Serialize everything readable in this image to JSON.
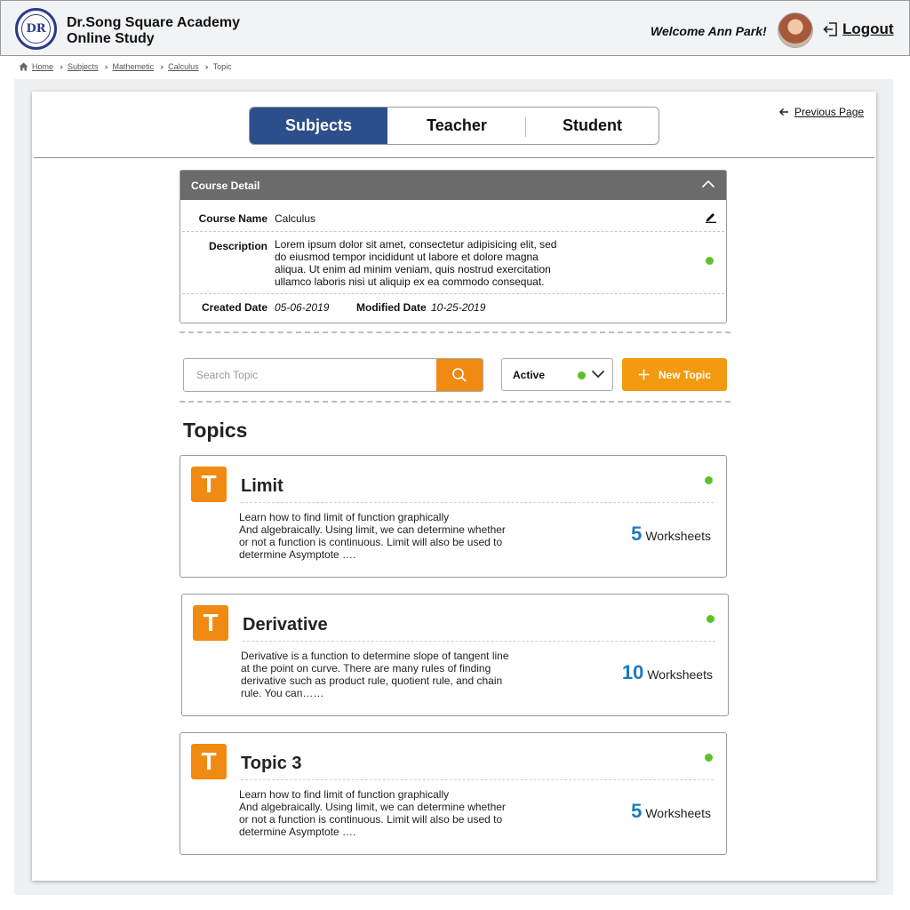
{
  "header": {
    "logo_text": "DR",
    "title_line1": "Dr.Song Square Academy",
    "title_line2": "Online Study",
    "welcome": "Welcome Ann Park!",
    "logout_label": "Logout"
  },
  "breadcrumb": {
    "items": [
      "Home",
      "Subjects",
      "Mathemetic",
      "Calculus",
      "Topic"
    ]
  },
  "tabs": {
    "subjects": "Subjects",
    "teacher": "Teacher",
    "student": "Student",
    "active": "Subjects",
    "active_color": "#2c4f8c"
  },
  "previous_page_label": "Previous Page",
  "course_detail": {
    "header": "Course Detail",
    "name_label": "Course Name",
    "name_value": "Calculus",
    "description_label": "Description",
    "description_lines": [
      "Lorem ipsum dolor sit amet, consectetur adipisicing elit, sed",
      "do eiusmod tempor incididunt ut labore et dolore magna",
      "aliqua. Ut enim ad minim veniam, quis nostrud exercitation",
      "ullamco laboris nisi ut aliquip ex ea commodo consequat."
    ],
    "created_label": "Created Date",
    "created_value": "05-06-2019",
    "modified_label": "Modified Date",
    "modified_value": "10-25-2019",
    "status_color": "#5cc22a"
  },
  "search": {
    "placeholder": "Search Topic",
    "button_color": "#f08a12"
  },
  "status_filter": {
    "value": "Active",
    "dot_color": "#5cc22a"
  },
  "new_topic_label": "New Topic",
  "topics_title": "Topics",
  "topics": [
    {
      "icon_letter": "T",
      "name": "Limit",
      "desc_lines": [
        "Learn how to find limit of function graphically",
        "And algebraically. Using limit, we can determine whether",
        "or not a function is continuous. Limit will also be used to",
        "determine Asymptote …."
      ],
      "worksheet_count": "5",
      "worksheet_label": "Worksheets"
    },
    {
      "icon_letter": "T",
      "name": "Derivative",
      "desc_lines": [
        "Derivative is a function to determine slope of tangent line",
        "at the point on curve. There are many rules of finding",
        "derivative such as product rule, quotient rule, and chain",
        "rule. You can……"
      ],
      "worksheet_count": "10",
      "worksheet_label": "Worksheets"
    },
    {
      "icon_letter": "T",
      "name": "Topic 3",
      "desc_lines": [
        "Learn how to find limit of function graphically",
        "And algebraically. Using limit, we can determine whether",
        "or not a function is continuous. Limit will also be used to",
        "determine Asymptote …."
      ],
      "worksheet_count": "5",
      "worksheet_label": "Worksheets"
    }
  ]
}
